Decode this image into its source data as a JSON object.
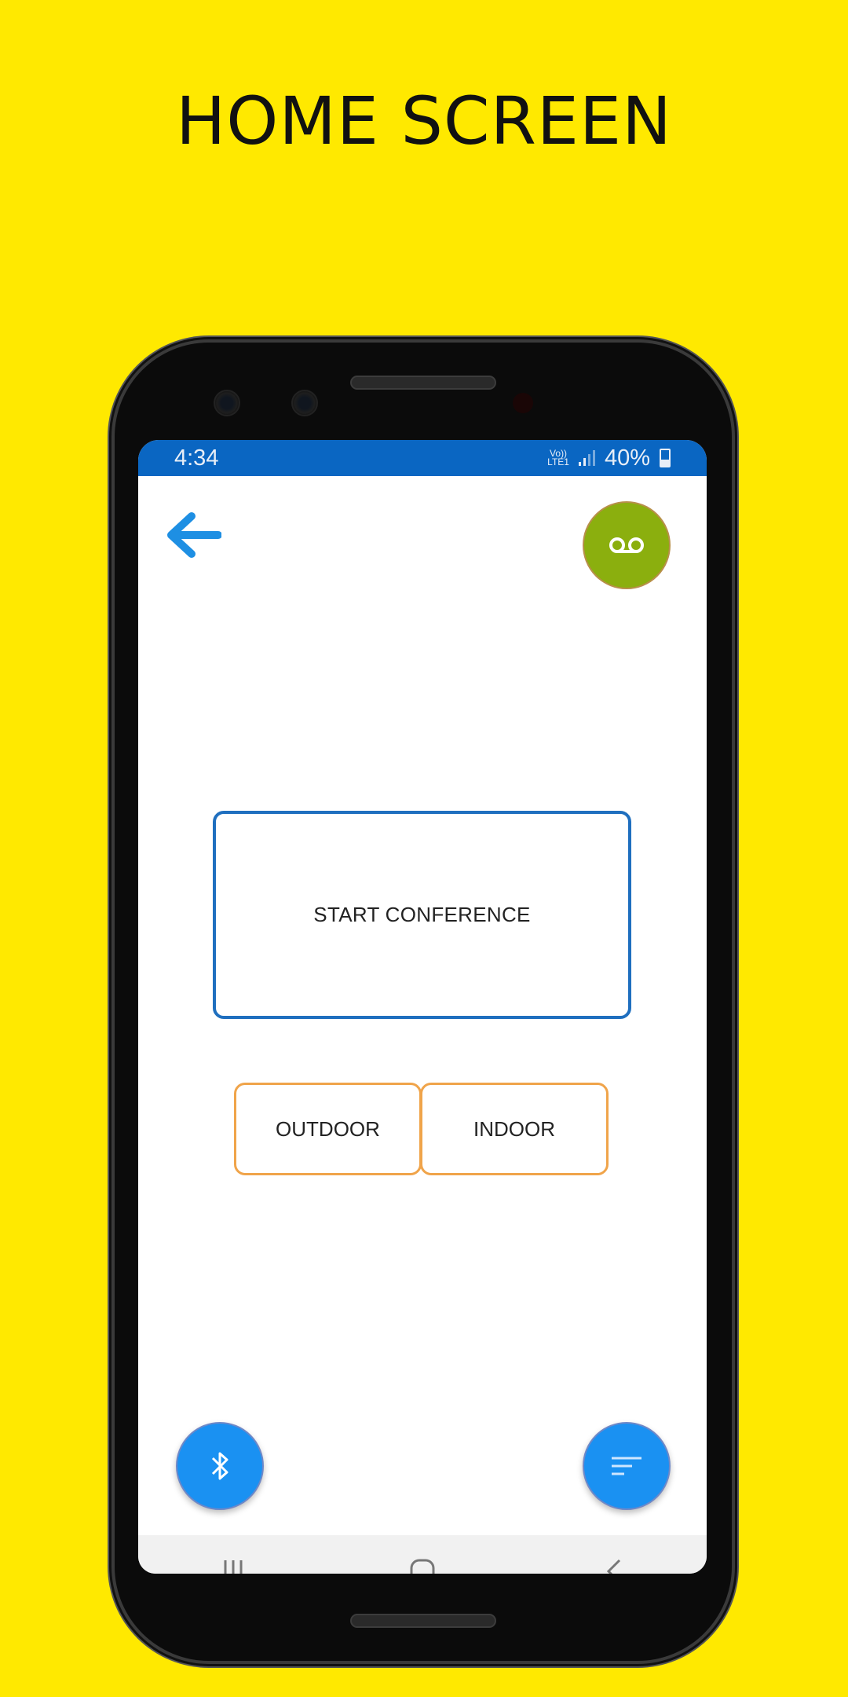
{
  "page": {
    "headline": "HOME SCREEN",
    "background_color": "#FFE900"
  },
  "statusbar": {
    "time": "4:34",
    "volte_line1": "Vo))",
    "volte_line2": "LTE1",
    "battery_text": "40%",
    "color": "#0A66C2"
  },
  "topbar": {
    "back_icon": "arrow-left-icon",
    "voicemail_icon": "voicemail-icon",
    "voicemail_color": "#8BAF0E"
  },
  "main": {
    "start_conference_label": "START CONFERENCE",
    "outdoor_label": "OUTDOOR",
    "indoor_label": "INDOOR"
  },
  "fabs": {
    "bluetooth_icon": "bluetooth-icon",
    "menu_icon": "sort-menu-icon",
    "color": "#1A91F2"
  },
  "navbar": {
    "recent_icon": "recent-apps-icon",
    "home_icon": "home-icon",
    "back_icon": "nav-back-icon"
  }
}
